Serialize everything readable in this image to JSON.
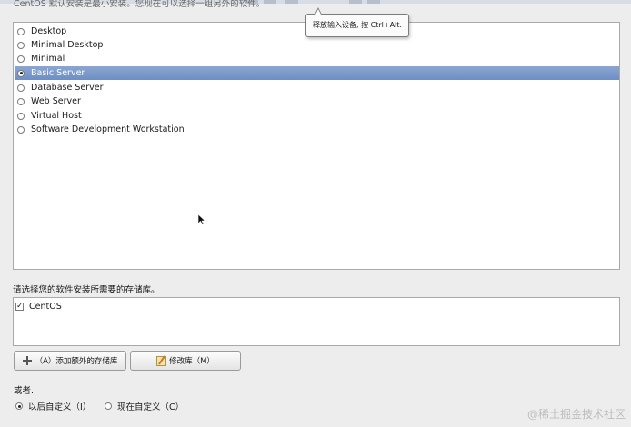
{
  "header": {
    "description": "CentOS 默认安装是最小安装。您现在可以选择一组另外的软件。"
  },
  "tooltip": {
    "text": "释放输入设备, 按 Ctrl+Alt."
  },
  "install_options": {
    "items": [
      {
        "label": "Desktop",
        "selected": false
      },
      {
        "label": "Minimal Desktop",
        "selected": false
      },
      {
        "label": "Minimal",
        "selected": false
      },
      {
        "label": "Basic Server",
        "selected": true
      },
      {
        "label": "Database Server",
        "selected": false
      },
      {
        "label": "Web Server",
        "selected": false
      },
      {
        "label": "Virtual Host",
        "selected": false
      },
      {
        "label": "Software Development Workstation",
        "selected": false
      }
    ]
  },
  "repo": {
    "label": "请选择您的软件安装所需要的存储库。",
    "items": [
      {
        "label": "CentOS",
        "checked": true
      }
    ]
  },
  "buttons": {
    "add_repo": "（A）添加额外的存储库",
    "modify_repo": "修改库（M）"
  },
  "customize": {
    "or_label": "或者.",
    "later": "以后自定义（I）",
    "now": "现在自定义（C）",
    "selected": "later"
  },
  "watermark": "@稀土掘金技术社区",
  "colors": {
    "selection": "#7b98c9",
    "background": "#ededed"
  }
}
